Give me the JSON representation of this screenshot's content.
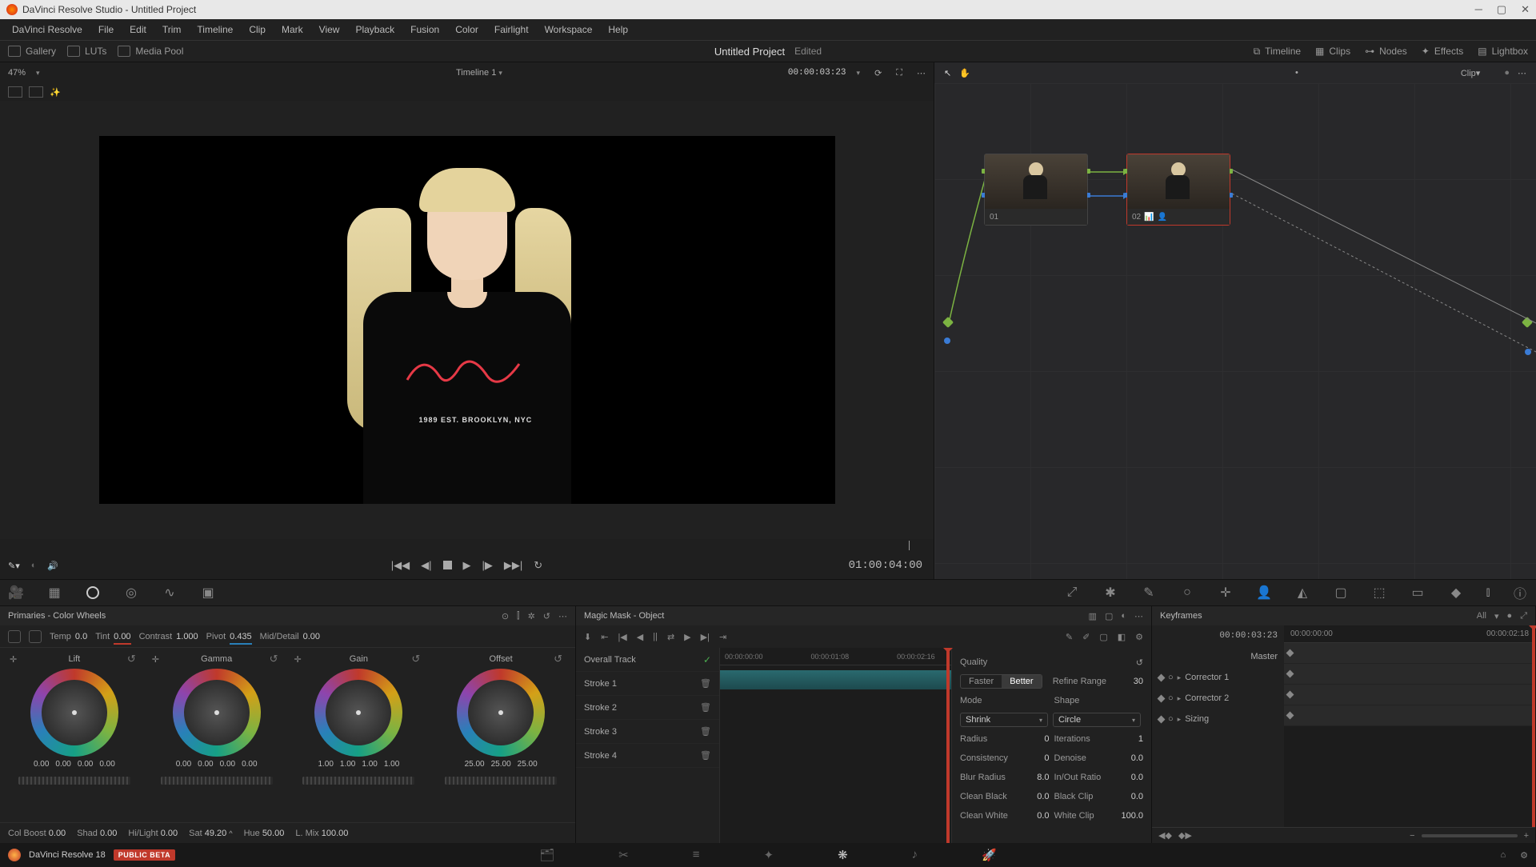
{
  "titlebar": {
    "text": "DaVinci Resolve Studio - Untitled Project"
  },
  "menu": {
    "items": [
      "DaVinci Resolve",
      "File",
      "Edit",
      "Trim",
      "Timeline",
      "Clip",
      "Mark",
      "View",
      "Playback",
      "Fusion",
      "Color",
      "Fairlight",
      "Workspace",
      "Help"
    ]
  },
  "topbar": {
    "gallery": "Gallery",
    "luts": "LUTs",
    "mediapool": "Media Pool",
    "project": "Untitled Project",
    "edited": "Edited",
    "timeline": "Timeline",
    "clips": "Clips",
    "nodes": "Nodes",
    "effects": "Effects",
    "lightbox": "Lightbox"
  },
  "viewer": {
    "zoom": "47%",
    "timeline_name": "Timeline 1",
    "timecode": "00:00:03:23",
    "shirt_text": "1989 EST. BROOKLYN, NYC",
    "duration": "01:00:04:00"
  },
  "node_panel": {
    "mode": "Clip",
    "node1": "01",
    "node2": "02"
  },
  "primaries": {
    "title": "Primaries - Color Wheels",
    "temp_l": "Temp",
    "temp_v": "0.0",
    "tint_l": "Tint",
    "tint_v": "0.00",
    "contrast_l": "Contrast",
    "contrast_v": "1.000",
    "pivot_l": "Pivot",
    "pivot_v": "0.435",
    "md_l": "Mid/Detail",
    "md_v": "0.00",
    "wheels": {
      "lift": {
        "label": "Lift",
        "nums": [
          "0.00",
          "0.00",
          "0.00",
          "0.00"
        ]
      },
      "gamma": {
        "label": "Gamma",
        "nums": [
          "0.00",
          "0.00",
          "0.00",
          "0.00"
        ]
      },
      "gain": {
        "label": "Gain",
        "nums": [
          "1.00",
          "1.00",
          "1.00",
          "1.00"
        ]
      },
      "offset": {
        "label": "Offset",
        "nums": [
          "25.00",
          "25.00",
          "25.00"
        ]
      }
    },
    "colboost_l": "Col Boost",
    "colboost_v": "0.00",
    "shad_l": "Shad",
    "shad_v": "0.00",
    "hilight_l": "Hi/Light",
    "hilight_v": "0.00",
    "sat_l": "Sat",
    "sat_v": "49.20",
    "hue_l": "Hue",
    "hue_v": "50.00",
    "lmix_l": "L. Mix",
    "lmix_v": "100.00"
  },
  "magicmask": {
    "title": "Magic Mask - Object",
    "overall": "Overall Track",
    "strokes": [
      "Stroke 1",
      "Stroke 2",
      "Stroke 3",
      "Stroke 4"
    ],
    "ruler": [
      "00:00:00:00",
      "00:00:01:08",
      "00:00:02:16"
    ],
    "quality_l": "Quality",
    "faster": "Faster",
    "better": "Better",
    "refine_l": "Refine Range",
    "refine_v": "30",
    "mode_l": "Mode",
    "mode_v": "Shrink",
    "shape_l": "Shape",
    "shape_v": "Circle",
    "radius_l": "Radius",
    "radius_v": "0",
    "iter_l": "Iterations",
    "iter_v": "1",
    "cons_l": "Consistency",
    "cons_v": "0",
    "den_l": "Denoise",
    "den_v": "0.0",
    "blur_l": "Blur Radius",
    "blur_v": "8.0",
    "io_l": "In/Out Ratio",
    "io_v": "0.0",
    "cb_l": "Clean Black",
    "cb_v": "0.0",
    "bc_l": "Black Clip",
    "bc_v": "0.0",
    "cw_l": "Clean White",
    "cw_v": "0.0",
    "wc_l": "White Clip",
    "wc_v": "100.0"
  },
  "keyframes": {
    "title": "Keyframes",
    "all": "All",
    "tc": "00:00:03:23",
    "start": "00:00:00:00",
    "end": "00:00:02:18",
    "master": "Master",
    "tracks": [
      "Corrector 1",
      "Corrector 2",
      "Sizing"
    ]
  },
  "footer": {
    "app": "DaVinci Resolve 18",
    "badge": "PUBLIC BETA"
  }
}
